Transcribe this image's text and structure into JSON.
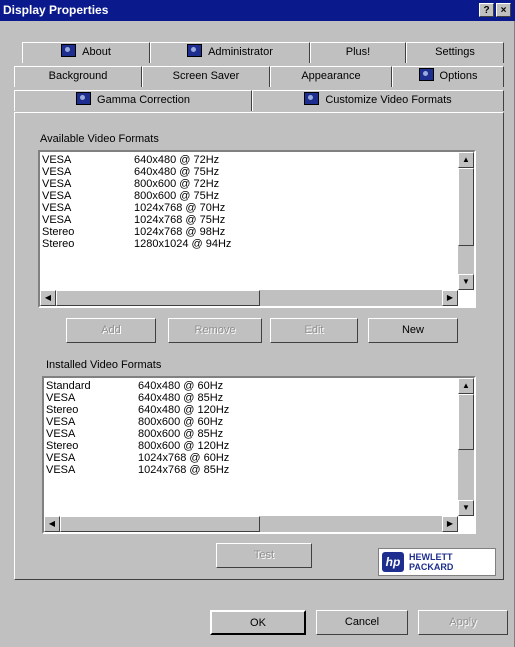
{
  "window": {
    "title": "Display Properties",
    "help_glyph": "?",
    "close_glyph": "×"
  },
  "tabs": {
    "row1": [
      "About",
      "Administrator",
      "Plus!",
      "Settings"
    ],
    "row2": [
      "Background",
      "Screen Saver",
      "Appearance",
      "Options"
    ],
    "row3": [
      "Gamma Correction",
      "Customize Video Formats"
    ]
  },
  "available": {
    "label": "Available Video Formats",
    "rows": [
      [
        "VESA",
        "640x480 @ 72Hz"
      ],
      [
        "VESA",
        "640x480 @ 75Hz"
      ],
      [
        "VESA",
        "800x600 @ 72Hz"
      ],
      [
        "VESA",
        "800x600 @ 75Hz"
      ],
      [
        "VESA",
        "1024x768 @ 70Hz"
      ],
      [
        "VESA",
        "1024x768 @ 75Hz"
      ],
      [
        "Stereo",
        "1024x768 @ 98Hz"
      ],
      [
        "Stereo",
        "1280x1024 @ 94Hz"
      ]
    ]
  },
  "buttons": {
    "add": "Add",
    "remove": "Remove",
    "edit": "Edit",
    "new": "New",
    "test": "Test",
    "ok": "OK",
    "cancel": "Cancel",
    "apply": "Apply"
  },
  "installed": {
    "label": "Installed Video Formats",
    "rows": [
      [
        "Standard",
        "640x480 @ 60Hz"
      ],
      [
        "VESA",
        "640x480 @ 85Hz"
      ],
      [
        "Stereo",
        "640x480 @ 120Hz"
      ],
      [
        "VESA",
        "800x600 @ 60Hz"
      ],
      [
        "VESA",
        "800x600 @ 85Hz"
      ],
      [
        "Stereo",
        "800x600 @ 120Hz"
      ],
      [
        "VESA",
        "1024x768 @ 60Hz"
      ],
      [
        "VESA",
        "1024x768 @ 85Hz"
      ]
    ]
  },
  "logo": {
    "line1": "HEWLETT",
    "line2": "PACKARD",
    "mark": "hp"
  },
  "colors": {
    "titlebar": "#0a1a8c",
    "face": "#c0c0c0",
    "icon": "#1e2e8f"
  }
}
